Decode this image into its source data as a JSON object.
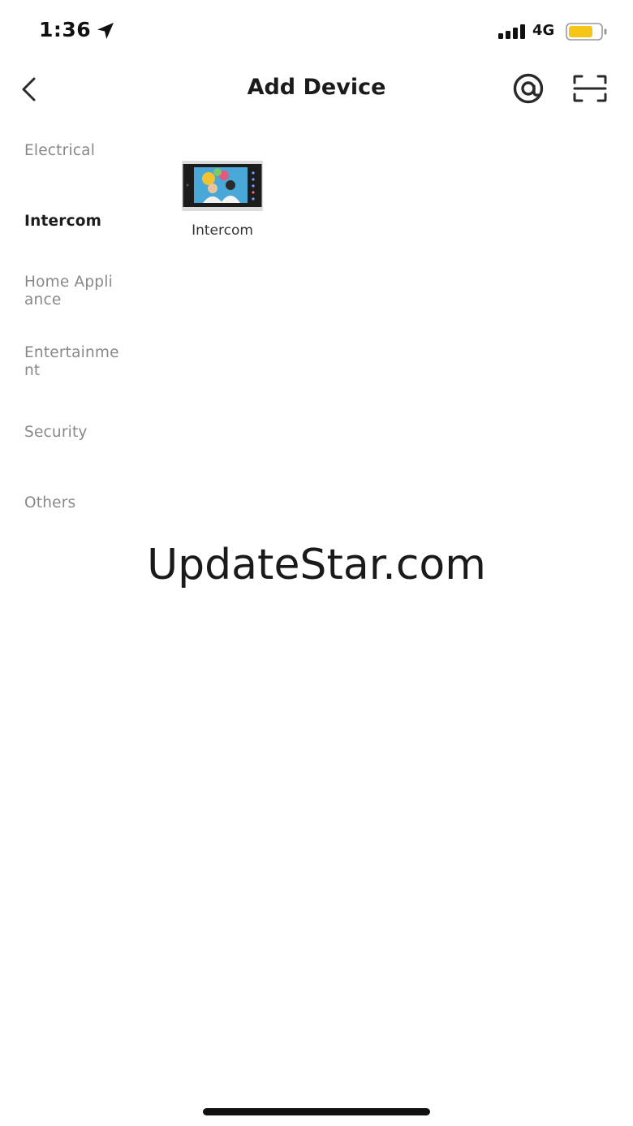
{
  "status_bar": {
    "time": "1:36",
    "network": "4G",
    "battery_color": "#f5c518",
    "icons": [
      "location-arrow-icon",
      "signal-bars-icon",
      "battery-icon"
    ]
  },
  "header": {
    "title": "Add Device",
    "icons": [
      "back-chevron-icon",
      "at-sign-icon",
      "scan-icon"
    ]
  },
  "sidebar": {
    "items": [
      {
        "label": "Electrical",
        "active": false
      },
      {
        "label": "Intercom",
        "active": true
      },
      {
        "label": "Home Appliance",
        "active": false
      },
      {
        "label": "Entertainment",
        "active": false
      },
      {
        "label": "Security",
        "active": false
      },
      {
        "label": "Others",
        "active": false
      }
    ]
  },
  "devices": [
    {
      "label": "Intercom",
      "icon": "intercom-monitor-thumbnail"
    }
  ],
  "watermark": "UpdateStar.com"
}
